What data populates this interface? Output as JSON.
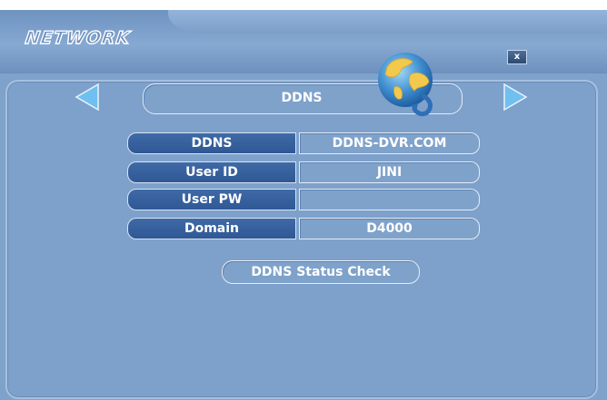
{
  "window": {
    "title": "NETWORK",
    "close_label": "x"
  },
  "page": {
    "heading": "DDNS"
  },
  "form": {
    "rows": [
      {
        "label": "DDNS",
        "value": "DDNS-DVR.COM"
      },
      {
        "label": "User ID",
        "value": "JINI"
      },
      {
        "label": "User PW",
        "value": ""
      },
      {
        "label": "Domain",
        "value": "D4000"
      }
    ]
  },
  "actions": {
    "status_check_label": "DDNS Status Check"
  },
  "icons": {
    "prev": "arrow-left-icon",
    "next": "arrow-right-icon",
    "globe": "globe-icon",
    "close": "close-icon"
  },
  "colors": {
    "background": "#7fa2cb",
    "label_cell": "#3a65a1",
    "arrow": "#6fc0ef",
    "text": "#ffffff"
  }
}
